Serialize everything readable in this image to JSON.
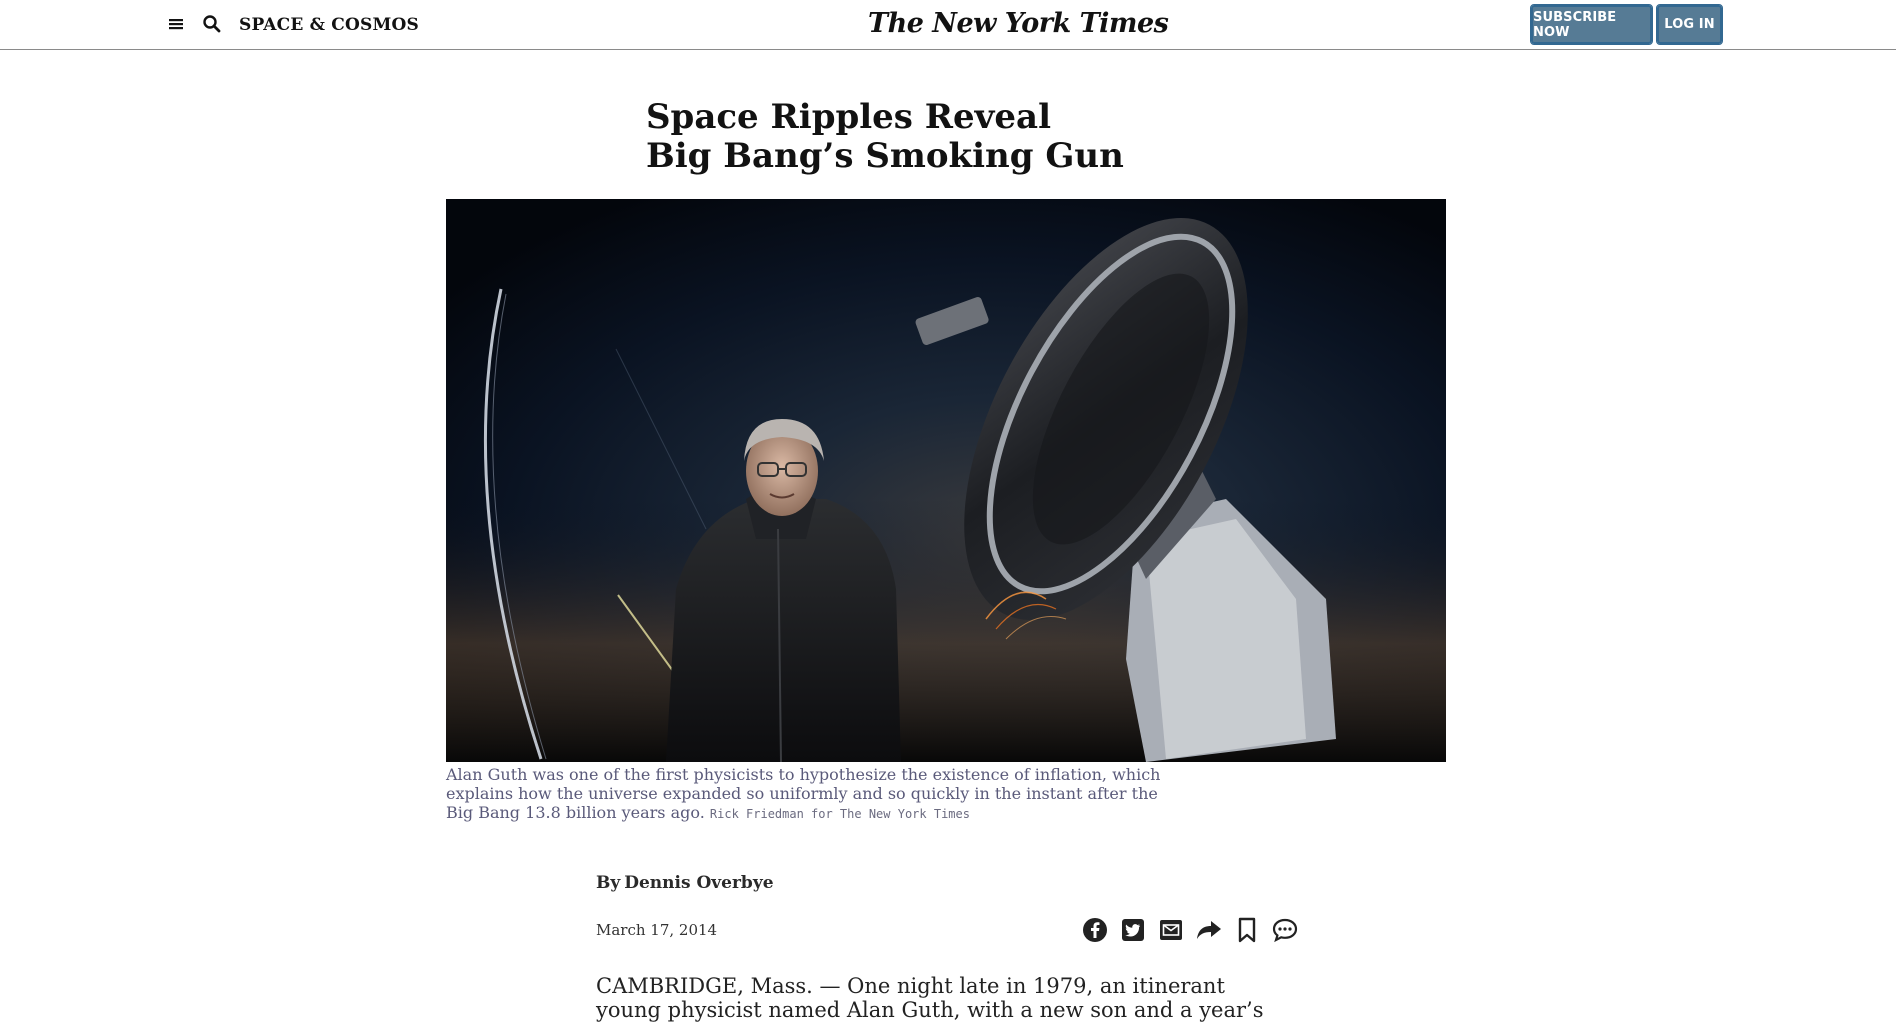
{
  "header": {
    "section_label": "SPACE & COSMOS",
    "logo_text": "The New York Times",
    "subscribe_label": "SUBSCRIBE NOW",
    "login_label": "LOG IN",
    "menu_icon": "hamburger-icon",
    "search_icon": "search-icon"
  },
  "article": {
    "headline_line1": "Space Ripples Reveal",
    "headline_line2": "Big Bang’s Smoking Gun",
    "caption": "Alan Guth was one of the first physicists to hypothesize the existence of inflation, which explains how the universe expanded so uniformly and so quickly in the instant after the Big Bang 13.8 billion years ago.",
    "photo_credit": "Rick Friedman for The New York Times",
    "byline_prefix": "By",
    "author": "Dennis Overbye",
    "date": "March 17, 2014",
    "body_first_lines": "CAMBRIDGE, Mass. — One night late in 1979, an itinerant young physicist named Alan Guth, with a new son and a year’s"
  },
  "share_icons": [
    "facebook-icon",
    "twitter-icon",
    "email-icon",
    "share-icon",
    "bookmark-icon",
    "comment-icon"
  ],
  "colors": {
    "button_bg": "#567b95",
    "button_border": "#326891",
    "caption_text": "#5a5a7a"
  }
}
